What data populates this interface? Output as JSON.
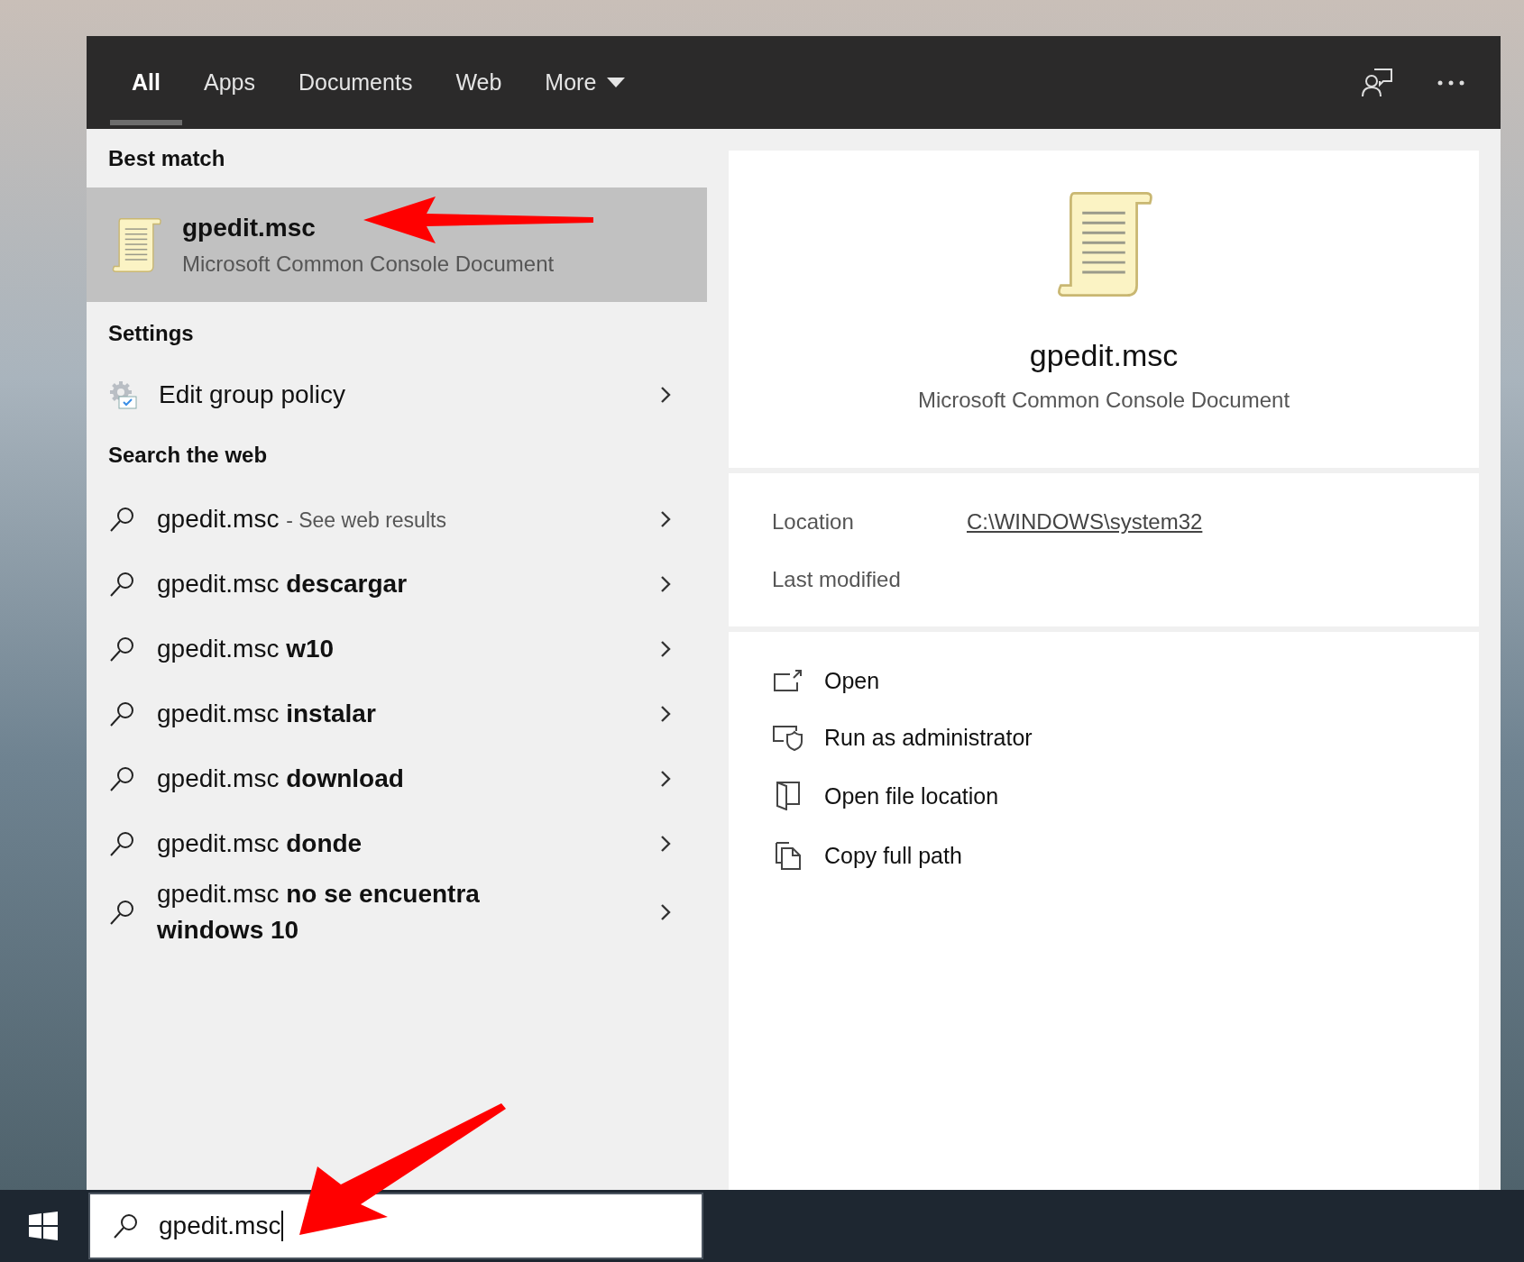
{
  "tabs": [
    {
      "label": "All",
      "selected": true
    },
    {
      "label": "Apps",
      "selected": false
    },
    {
      "label": "Documents",
      "selected": false
    },
    {
      "label": "Web",
      "selected": false
    },
    {
      "label": "More",
      "selected": false,
      "kind": "dropdown"
    }
  ],
  "best_match": {
    "heading": "Best match",
    "title": "gpedit.msc",
    "subtitle": "Microsoft Common Console Document",
    "selected": true
  },
  "settings": {
    "heading": "Settings",
    "items": [
      {
        "label": "Edit group policy"
      }
    ]
  },
  "web": {
    "heading": "Search the web",
    "items": [
      {
        "text": "gpedit.msc",
        "hint": "- See web results"
      },
      {
        "text": "gpedit.msc **descargar**"
      },
      {
        "text": "gpedit.msc **w10**"
      },
      {
        "text": "gpedit.msc **instalar**"
      },
      {
        "text": "gpedit.msc **download**"
      },
      {
        "text": "gpedit.msc **donde**"
      },
      {
        "text": "gpedit.msc **no se encuentra windows 10**"
      }
    ]
  },
  "preview": {
    "title": "gpedit.msc",
    "subtitle": "Microsoft Common Console Document",
    "details": [
      {
        "label": "Location",
        "value": "C:\\WINDOWS\\system32"
      },
      {
        "label": "Last modified"
      }
    ],
    "actions": [
      {
        "label": "Open",
        "kind": "open"
      },
      {
        "label": "Run as administrator",
        "kind": "admin"
      },
      {
        "label": "Open file location",
        "kind": "folder"
      },
      {
        "label": "Copy full path",
        "kind": "copy"
      }
    ]
  },
  "search_box": {
    "value": "gpedit.msc"
  }
}
